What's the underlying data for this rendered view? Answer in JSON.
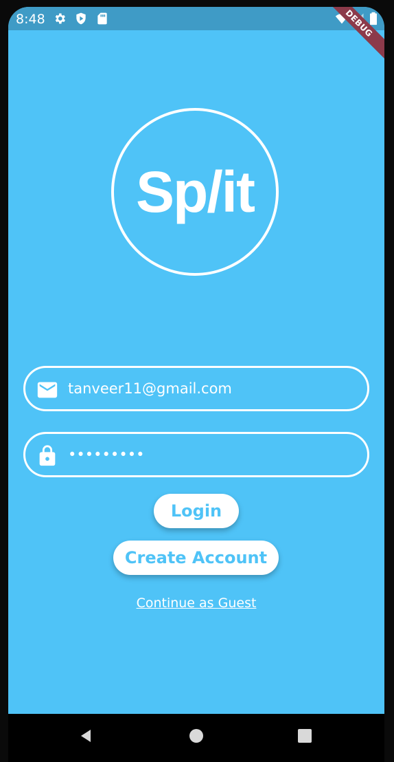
{
  "status_bar": {
    "time": "8:48",
    "icons": [
      "gear-icon",
      "play-shield-icon",
      "sd-card-icon",
      "wifi-icon",
      "no-signal-icon",
      "battery-icon"
    ],
    "debug_label": "DEBUG"
  },
  "logo": {
    "text": "Sp/it"
  },
  "login_form": {
    "email_icon": "email-icon",
    "email_value": "tanveer11@gmail.com",
    "password_icon": "lock-icon",
    "password_value": "•••••••••"
  },
  "buttons": {
    "login_label": "Login",
    "create_account_label": "Create Account",
    "guest_label": "Continue as Guest"
  },
  "nav_bar": {
    "icons": [
      "back-icon",
      "home-icon",
      "recents-icon"
    ]
  },
  "colors": {
    "background": "#4fc3f7",
    "status_bar": "#3f9bc6",
    "accent_text": "#4fc3f7",
    "debug_banner": "#8c3a4a"
  }
}
